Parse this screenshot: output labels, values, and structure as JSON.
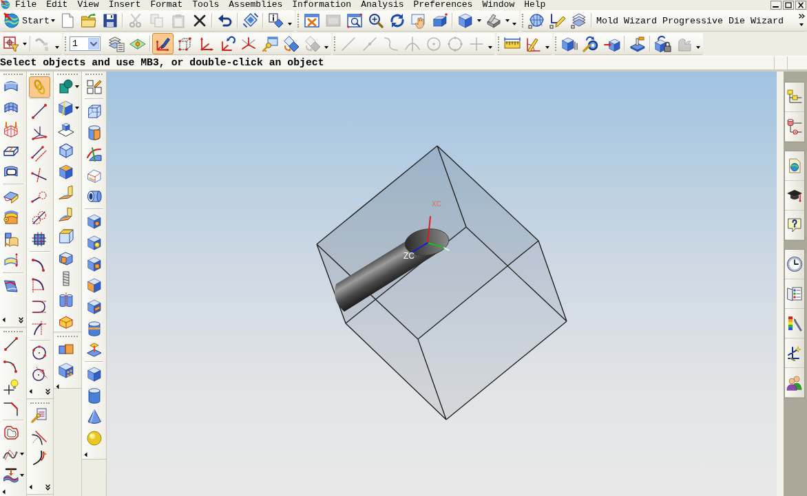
{
  "menu_bar": [
    "File",
    "Edit",
    "View",
    "Insert",
    "Format",
    "Tools",
    "Assemblies",
    "Information",
    "Analysis",
    "Preferences",
    "Window",
    "Help"
  ],
  "toolbar_rows": [
    {
      "toolbars": [
        {
          "start": {
            "label": "Start"
          },
          "groups": [
            [
              {
                "disabled": false,
                "on": false,
                "menu": false
              },
              {
                "disabled": false,
                "on": false,
                "menu": false
              },
              {
                "disabled": false,
                "on": false,
                "menu": false
              }
            ],
            [
              {
                "disabled": true,
                "on": false,
                "menu": false
              },
              {
                "disabled": true,
                "on": false,
                "menu": false
              },
              {
                "disabled": true,
                "on": false,
                "menu": false
              },
              {
                "disabled": false,
                "on": false,
                "menu": false
              }
            ],
            [
              {
                "disabled": false,
                "on": false,
                "menu": false
              }
            ],
            [
              {
                "disabled": false,
                "on": false,
                "menu": false
              }
            ],
            [
              {
                "disabled": false,
                "on": false,
                "menu": false
              }
            ]
          ]
        },
        {
          "groups": [
            [
              {
                "disabled": false,
                "on": false,
                "menu": false
              },
              {
                "disabled": true,
                "on": false,
                "menu": false
              },
              {
                "disabled": false,
                "on": false,
                "menu": false
              },
              {
                "disabled": false,
                "on": false,
                "menu": false
              },
              {
                "disabled": false,
                "on": false,
                "menu": false
              },
              {
                "disabled": false,
                "on": false,
                "menu": false
              },
              {
                "disabled": false,
                "on": false,
                "menu": false
              }
            ],
            [
              {
                "disabled": false,
                "on": false,
                "menu": true
              },
              {
                "disabled": false,
                "on": false,
                "menu": true
              }
            ]
          ]
        },
        {
          "groups": [
            [
              {
                "disabled": false,
                "on": false,
                "menu": false
              },
              {
                "disabled": false,
                "on": false,
                "menu": false
              },
              {
                "disabled": false,
                "on": false,
                "menu": false
              }
            ]
          ],
          "commands": [
            "Mold Wizard",
            "Progressive Die Wizard"
          ]
        }
      ]
    },
    {
      "toolbars": [
        {
          "groups": [
            [
              {
                "disabled": false,
                "on": false,
                "menu": true
              }
            ],
            [
              {
                "disabled": true,
                "on": false,
                "menu": false
              }
            ]
          ]
        },
        {
          "layer_select": {
            "value": "1"
          },
          "groups": [
            [
              {
                "disabled": false,
                "on": false,
                "menu": false
              },
              {
                "disabled": false,
                "on": false,
                "menu": false
              }
            ],
            [
              {
                "disabled": false,
                "on": true,
                "menu": false
              },
              {
                "disabled": false,
                "on": false,
                "menu": false
              },
              {
                "disabled": false,
                "on": false,
                "menu": false
              },
              {
                "disabled": false,
                "on": false,
                "menu": false
              },
              {
                "disabled": false,
                "on": false,
                "menu": false
              },
              {
                "disabled": false,
                "on": false,
                "menu": false
              },
              {
                "disabled": false,
                "on": false,
                "menu": false
              },
              {
                "disabled": true,
                "on": false,
                "menu": false
              }
            ]
          ]
        },
        {
          "groups": [
            [
              {
                "disabled": true,
                "on": false,
                "menu": false
              },
              {
                "disabled": true,
                "on": false,
                "menu": false
              },
              {
                "disabled": true,
                "on": false,
                "menu": false
              },
              {
                "disabled": true,
                "on": false,
                "menu": false
              },
              {
                "disabled": true,
                "on": false,
                "menu": false
              },
              {
                "disabled": true,
                "on": false,
                "menu": false
              },
              {
                "disabled": true,
                "on": false,
                "menu": false
              }
            ]
          ]
        },
        {
          "groups": [
            [
              {
                "disabled": false,
                "on": false,
                "menu": false
              },
              {
                "disabled": false,
                "on": false,
                "menu": false
              }
            ]
          ]
        },
        {
          "groups": [
            [
              {
                "disabled": false,
                "on": false,
                "menu": false
              },
              {
                "disabled": false,
                "on": false,
                "menu": false
              },
              {
                "disabled": false,
                "on": false,
                "menu": false
              }
            ],
            [
              {
                "disabled": false,
                "on": false,
                "menu": false
              }
            ],
            [
              {
                "disabled": false,
                "on": false,
                "menu": false
              },
              {
                "disabled": true,
                "on": false,
                "menu": false
              }
            ]
          ]
        }
      ]
    }
  ],
  "prompt": "Select objects and use MB3, or double-click an object",
  "left_toolbar_columns": [
    {
      "toolbars": [
        {
          "groups": [
            [
              {
                "disabled": false,
                "on": false,
                "menu": false
              },
              {
                "disabled": false,
                "on": false,
                "menu": false
              },
              {
                "disabled": false,
                "on": false,
                "menu": false
              },
              {
                "disabled": false,
                "on": false,
                "menu": false
              },
              {
                "disabled": false,
                "on": false,
                "menu": false
              }
            ],
            [
              {
                "disabled": false,
                "on": false,
                "menu": false
              },
              {
                "disabled": false,
                "on": false,
                "menu": false
              },
              {
                "disabled": false,
                "on": false,
                "menu": false
              },
              {
                "disabled": false,
                "on": false,
                "menu": false
              }
            ],
            [
              {
                "disabled": false,
                "on": false,
                "menu": false
              }
            ]
          ]
        },
        {
          "groups": [
            [
              {
                "disabled": false,
                "on": false,
                "menu": false
              },
              {
                "disabled": false,
                "on": false,
                "menu": false
              },
              {
                "disabled": false,
                "on": false,
                "menu": false
              },
              {
                "disabled": false,
                "on": false,
                "menu": false
              }
            ],
            [
              {
                "disabled": false,
                "on": false,
                "menu": false
              },
              {
                "disabled": false,
                "on": false,
                "menu": true
              },
              {
                "disabled": false,
                "on": false,
                "menu": true
              }
            ]
          ]
        }
      ]
    },
    {
      "toolbars": [
        {
          "groups": [
            [
              {
                "disabled": false,
                "on": true,
                "menu": false
              }
            ],
            [
              {
                "disabled": false,
                "on": false,
                "menu": false
              },
              {
                "disabled": false,
                "on": false,
                "menu": false
              },
              {
                "disabled": false,
                "on": false,
                "menu": false
              },
              {
                "disabled": false,
                "on": false,
                "menu": false
              },
              {
                "disabled": false,
                "on": false,
                "menu": false
              },
              {
                "disabled": false,
                "on": false,
                "menu": false
              },
              {
                "disabled": false,
                "on": false,
                "menu": false
              }
            ],
            [
              {
                "disabled": false,
                "on": false,
                "menu": false
              },
              {
                "disabled": false,
                "on": false,
                "menu": false
              },
              {
                "disabled": false,
                "on": false,
                "menu": false
              },
              {
                "disabled": false,
                "on": false,
                "menu": false
              }
            ],
            [
              {
                "disabled": false,
                "on": false,
                "menu": false
              },
              {
                "disabled": false,
                "on": false,
                "menu": false
              }
            ]
          ]
        },
        {
          "groups": [
            [
              {
                "disabled": false,
                "on": false,
                "menu": false
              },
              {
                "disabled": false,
                "on": false,
                "menu": false
              },
              {
                "disabled": false,
                "on": false,
                "menu": false
              }
            ]
          ]
        }
      ]
    },
    {
      "toolbars": [
        {
          "groups": [
            [
              {
                "disabled": false,
                "on": false,
                "menu": true
              },
              {
                "disabled": false,
                "on": false,
                "menu": true
              },
              {
                "disabled": false,
                "on": false,
                "menu": false
              },
              {
                "disabled": false,
                "on": false,
                "menu": false
              },
              {
                "disabled": false,
                "on": false,
                "menu": false
              },
              {
                "disabled": false,
                "on": false,
                "menu": false
              },
              {
                "disabled": false,
                "on": false,
                "menu": false
              },
              {
                "disabled": false,
                "on": false,
                "menu": false
              },
              {
                "disabled": false,
                "on": false,
                "menu": false
              },
              {
                "disabled": false,
                "on": false,
                "menu": false
              },
              {
                "disabled": false,
                "on": false,
                "menu": false
              },
              {
                "disabled": false,
                "on": false,
                "menu": false
              }
            ]
          ]
        },
        {
          "groups": [
            [
              {
                "disabled": false,
                "on": false,
                "menu": false
              },
              {
                "disabled": false,
                "on": false,
                "menu": false
              }
            ]
          ]
        }
      ]
    },
    {
      "toolbars": [
        {
          "groups": [
            [
              {
                "disabled": false,
                "on": false,
                "menu": false
              }
            ],
            [
              {
                "disabled": false,
                "on": false,
                "menu": false
              },
              {
                "disabled": false,
                "on": false,
                "menu": false
              },
              {
                "disabled": false,
                "on": false,
                "menu": false
              },
              {
                "disabled": false,
                "on": false,
                "menu": false
              },
              {
                "disabled": false,
                "on": false,
                "menu": false
              }
            ],
            [
              {
                "disabled": false,
                "on": false,
                "menu": false
              },
              {
                "disabled": false,
                "on": false,
                "menu": false
              },
              {
                "disabled": false,
                "on": false,
                "menu": false
              },
              {
                "disabled": false,
                "on": false,
                "menu": false
              },
              {
                "disabled": false,
                "on": false,
                "menu": false
              },
              {
                "disabled": false,
                "on": false,
                "menu": false
              },
              {
                "disabled": false,
                "on": false,
                "menu": false
              }
            ],
            [
              {
                "disabled": false,
                "on": false,
                "menu": false
              },
              {
                "disabled": false,
                "on": false,
                "menu": false
              },
              {
                "disabled": false,
                "on": false,
                "menu": false
              },
              {
                "disabled": false,
                "on": false,
                "menu": false
              }
            ]
          ]
        }
      ]
    }
  ],
  "graphics_window": {
    "triad_labels": [
      "XC",
      "ZC"
    ]
  }
}
